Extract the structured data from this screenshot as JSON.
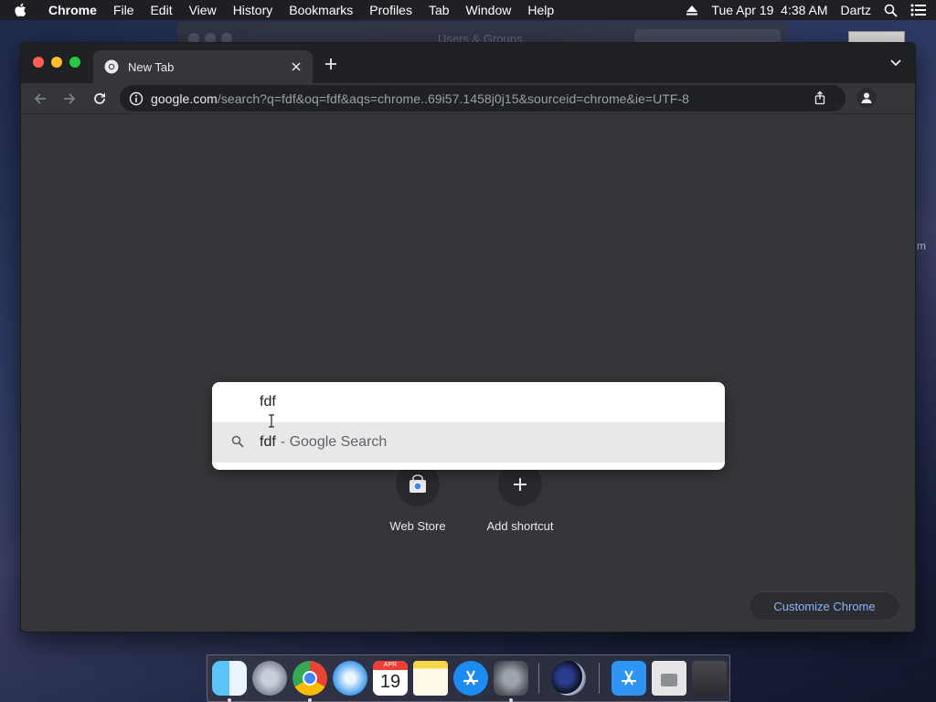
{
  "menubar": {
    "app_name": "Chrome",
    "items": [
      "File",
      "Edit",
      "View",
      "History",
      "Bookmarks",
      "Profiles",
      "Tab",
      "Window",
      "Help"
    ],
    "clock": "Tue Apr 19  4:38 AM",
    "user": "Dartz"
  },
  "background_window": {
    "title": "Users & Groups",
    "edge_text": "m"
  },
  "tab": {
    "title": "New Tab"
  },
  "omnibox": {
    "host": "google.com",
    "path": "/search?q=fdf&oq=fdf&aqs=chrome..69i57.1458j0j15&sourceid=chrome&ie=UTF-8"
  },
  "dropdown": {
    "query": "fdf",
    "suggestion_query": "fdf",
    "suggestion_desc": "- Google Search"
  },
  "shortcuts": [
    {
      "label": "Web Store",
      "icon": "chrome-web-store-icon"
    },
    {
      "label": "Add shortcut",
      "icon": "plus-icon"
    }
  ],
  "customize_label": "Customize Chrome",
  "dock": {
    "items": [
      "Finder",
      "Launchpad",
      "Google Chrome",
      "Safari",
      "Calendar",
      "Notes",
      "App Store",
      "System Preferences",
      "Cinema 4D",
      "Applications",
      "Downloads",
      "Trash"
    ],
    "calendar_month": "APR",
    "calendar_day": "19"
  },
  "colors": {
    "accent": "#8ab4f8",
    "window_bg": "#35363a",
    "tabstrip_bg": "#202124",
    "close_light": "#ff5f57",
    "minimize_light": "#febc2e",
    "zoom_light": "#28c840"
  }
}
